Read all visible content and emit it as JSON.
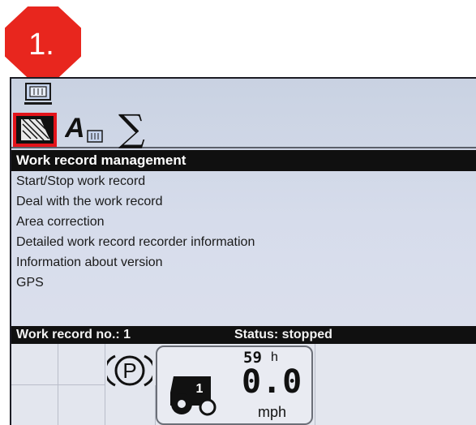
{
  "step_badge": {
    "label": "1."
  },
  "toolbar": {
    "tabs": [
      {
        "icon": "area-record-icon",
        "selected": true
      },
      {
        "icon": "text-settings-icon",
        "selected": false
      },
      {
        "icon": "sigma-sum-icon",
        "glyph": "∑",
        "selected": false
      }
    ]
  },
  "menu": {
    "title": "Work record management",
    "items": [
      "Start/Stop work record",
      "Deal with the work record",
      "Area correction",
      "Detailed work record recorder information",
      "Information about version",
      "GPS"
    ]
  },
  "status": {
    "record_no": "Work record no.: 1",
    "state": "Status: stopped"
  },
  "gauge": {
    "hours": "59",
    "hours_unit": "h",
    "speed": "0.0",
    "speed_unit": "mph",
    "implement_no": "1"
  },
  "colors": {
    "badge": "#e8261e",
    "selection": "#e3141b",
    "title_bar": "#101010",
    "screen_bg": "#d6dceb"
  }
}
